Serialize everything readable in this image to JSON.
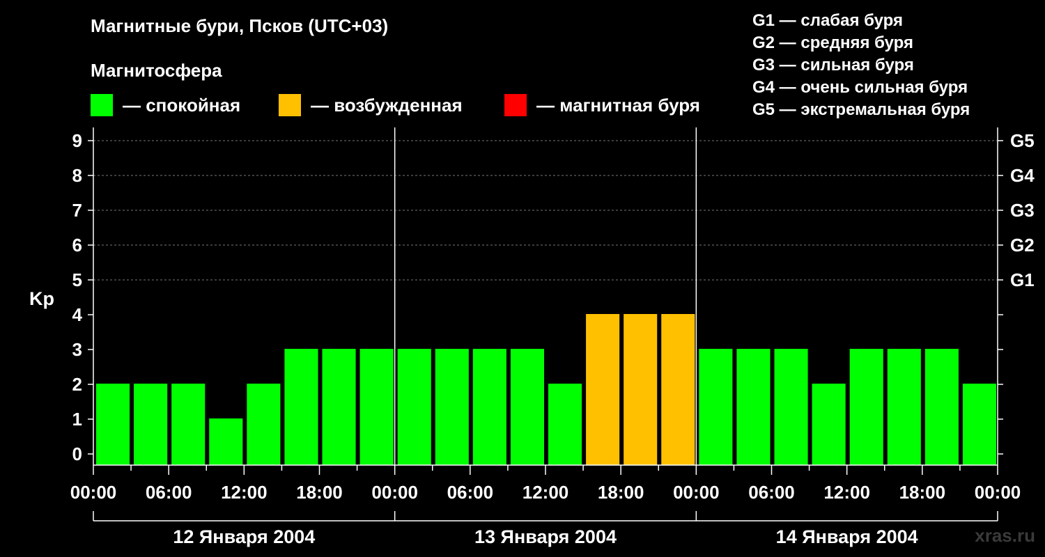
{
  "title": "Магнитные бури, Псков (UTC+03)",
  "subtitle": "Магнитосфера",
  "legend": [
    {
      "color": "#00ff00",
      "label": "— спокойная"
    },
    {
      "color": "#ffc000",
      "label": "— возбужденная"
    },
    {
      "color": "#ff0000",
      "label": "— магнитная буря"
    }
  ],
  "g_legend": [
    "G1 — слабая буря",
    "G2 — средняя буря",
    "G3 — сильная буря",
    "G4 — очень сильная буря",
    "G5 — экстремальная буря"
  ],
  "watermark": "xras.ru",
  "chart_data": {
    "type": "bar",
    "ylabel": "Kp",
    "ylim": [
      0,
      9
    ],
    "yticks": [
      0,
      1,
      2,
      3,
      4,
      5,
      6,
      7,
      8,
      9
    ],
    "right_ticks": [
      {
        "value": 5,
        "label": "G1"
      },
      {
        "value": 6,
        "label": "G2"
      },
      {
        "value": 7,
        "label": "G3"
      },
      {
        "value": 8,
        "label": "G4"
      },
      {
        "value": 9,
        "label": "G5"
      }
    ],
    "grid": "dashed at Kp 5-9",
    "bar_interval_hours": 3,
    "xtick_labels": [
      "00:00",
      "06:00",
      "12:00",
      "18:00",
      "00:00",
      "06:00",
      "12:00",
      "18:00",
      "00:00",
      "06:00",
      "12:00",
      "18:00",
      "00:00"
    ],
    "days": [
      "12 Января 2004",
      "13 Января 2004",
      "14 Января 2004"
    ],
    "values": [
      2,
      2,
      2,
      1,
      2,
      3,
      3,
      3,
      3,
      3,
      3,
      3,
      2,
      4,
      4,
      4,
      3,
      3,
      3,
      2,
      3,
      3,
      3,
      2
    ],
    "colors": {
      "quiet": "#00ff00",
      "unsettled": "#ffc000",
      "storm": "#ff0000"
    }
  }
}
